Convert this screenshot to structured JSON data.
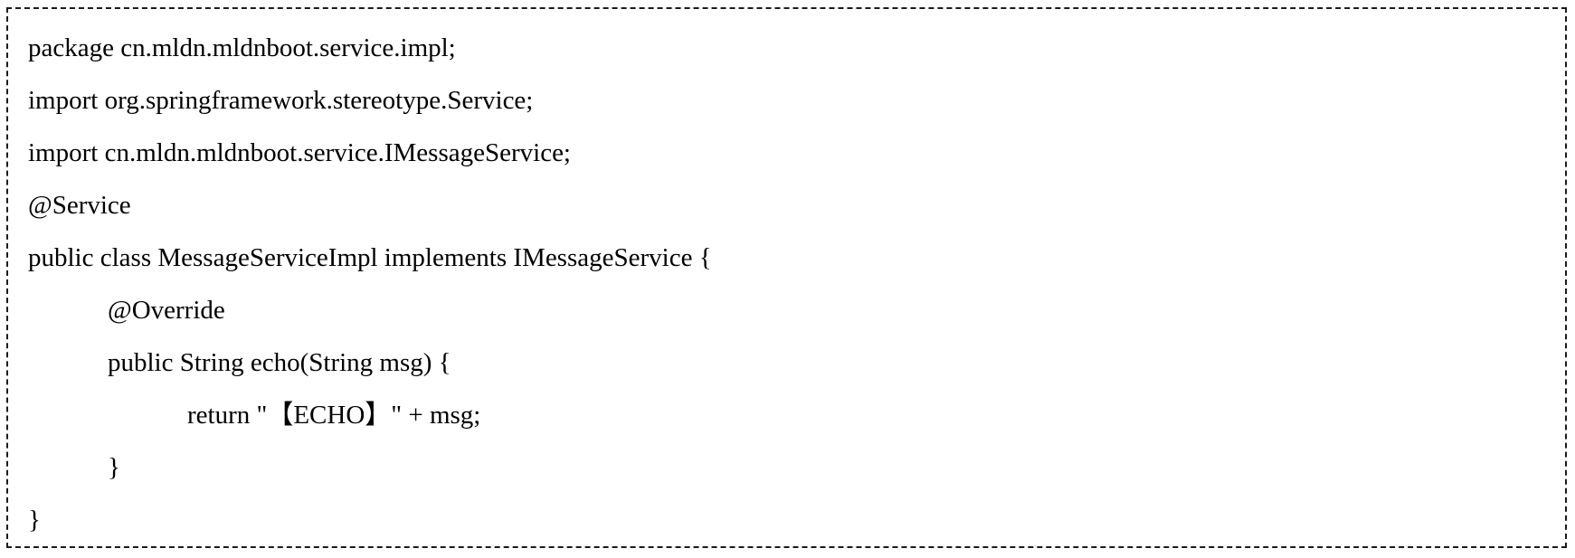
{
  "code": {
    "lines": [
      "package cn.mldn.mldnboot.service.impl;",
      "import org.springframework.stereotype.Service;",
      "import cn.mldn.mldnboot.service.IMessageService;",
      "@Service",
      "public class MessageServiceImpl implements IMessageService {",
      "@Override",
      "public String echo(String msg) {",
      "return \"【ECHO】\" + msg;",
      "}",
      "}"
    ]
  }
}
